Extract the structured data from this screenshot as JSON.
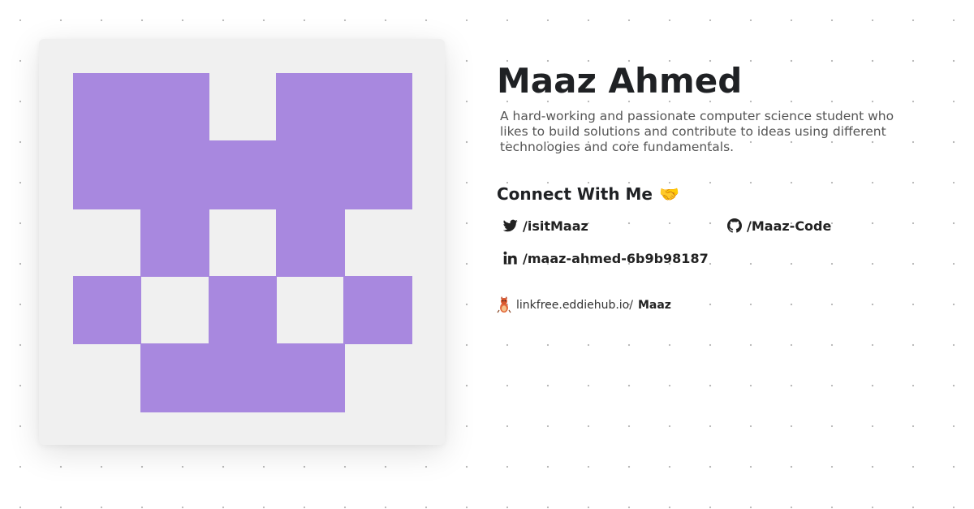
{
  "profile": {
    "name": "Maaz Ahmed",
    "bio": "A hard-working and passionate computer science student who likes to build solutions and contribute to ideas using different technologies and core fundamentals."
  },
  "connect": {
    "heading": "Connect With Me",
    "emoji": "🤝"
  },
  "socials": [
    {
      "icon": "twitter-icon",
      "label": "/isitMaaz"
    },
    {
      "icon": "github-icon",
      "label": "/Maaz-Code"
    },
    {
      "icon": "linkedin-icon",
      "label": "/maaz-ahmed-6b9b98187"
    }
  ],
  "linkfree": {
    "icon": "linkfree-logo-icon",
    "domain": "linkfree.eddiehub.io/",
    "username": "Maaz"
  },
  "colors": {
    "avatar_fill": "#a888df",
    "avatar_bg": "#f0f0f0"
  }
}
